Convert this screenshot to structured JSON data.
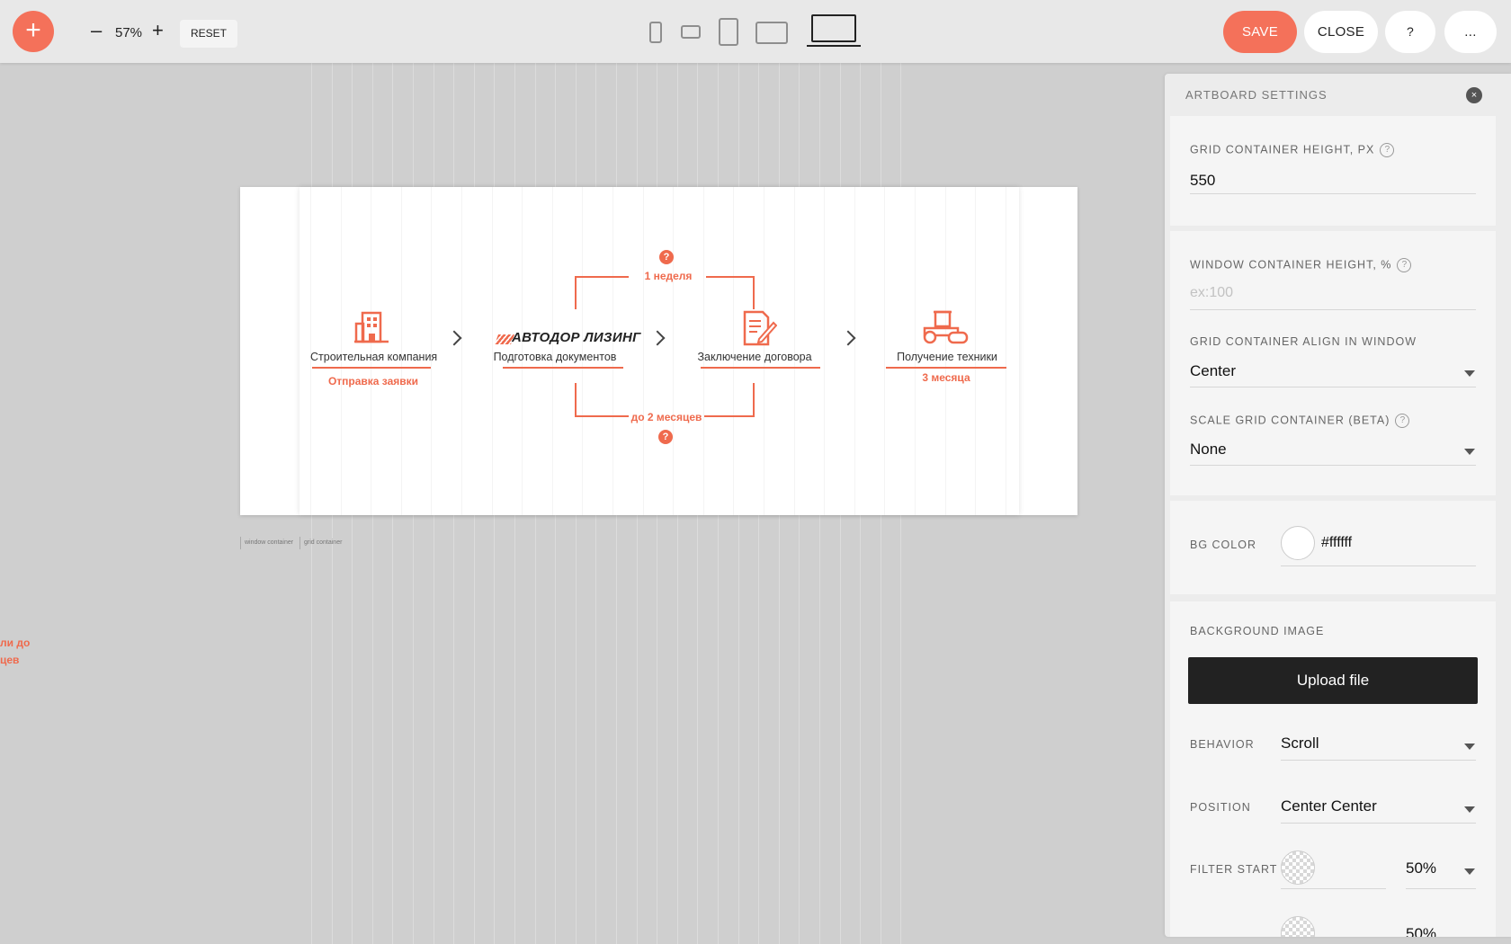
{
  "toolbar": {
    "add_label": "+",
    "zoom_minus": "–",
    "zoom_level": "57%",
    "zoom_plus": "+",
    "reset_label": "RESET",
    "save_label": "SAVE",
    "close_label": "CLOSE",
    "help_label": "?",
    "more_label": "..."
  },
  "artboard": {
    "steps": [
      {
        "label": "Строительная компания",
        "sub": "Отправка заявки"
      },
      {
        "label": "Подготовка документов",
        "brand": "АВТОДОР ЛИЗИНГ"
      },
      {
        "label": "Заключение договора"
      },
      {
        "label": "Получение техники",
        "sub": "3 месяца"
      }
    ],
    "top_duration": "1 неделя",
    "bottom_duration": "до 2 месяцев",
    "qmark": "?"
  },
  "container_labels": {
    "window": "window container",
    "grid": "grid container"
  },
  "offscreen_text": [
    "ли до",
    "цев"
  ],
  "panel": {
    "title": "ARTBOARD SETTINGS",
    "close_icon": "×",
    "help_glyph": "?",
    "grid_height_label": "GRID CONTAINER HEIGHT, PX",
    "grid_height_value": "550",
    "window_height_label": "WINDOW CONTAINER HEIGHT, %",
    "window_height_placeholder": "ex:100",
    "align_label": "GRID CONTAINER ALIGN IN WINDOW",
    "align_value": "Center",
    "scale_label": "SCALE GRID CONTAINER (BETA)",
    "scale_value": "None",
    "bg_color_label": "BG COLOR",
    "bg_color_value": "#ffffff",
    "bg_image_label": "BACKGROUND IMAGE",
    "upload_label": "Upload file",
    "behavior_label": "BEHAVIOR",
    "behavior_value": "Scroll",
    "position_label": "POSITION",
    "position_value": "Center Center",
    "filter_start_label": "FILTER START",
    "filter_start_value": "50%",
    "filter_end_value": "50%"
  },
  "colors": {
    "accent": "#f4715a",
    "brand_orange": "#ef6a4d"
  },
  "icons": [
    "building-icon",
    "document-icon",
    "roller-truck-icon",
    "chevron-right-icon",
    "phone-icon",
    "tablet-icon",
    "desktop-icon"
  ]
}
